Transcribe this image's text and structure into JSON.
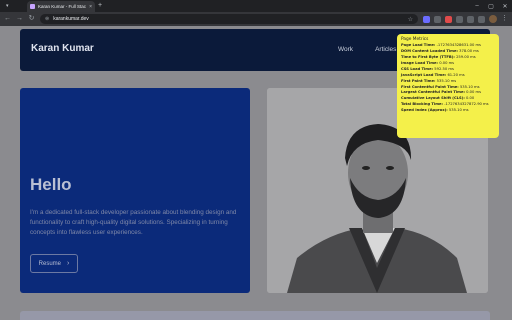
{
  "browser": {
    "tab_title": "Karan Kumar - Full Stack Dev",
    "tab_close": "×",
    "new_tab": "+",
    "url": "karankumar.dev",
    "window_controls": [
      "–",
      "▢",
      "✕"
    ],
    "ext_colors": [
      "#6b6cff",
      "#9aa0a6",
      "#e04b4b",
      "#9aa0a6",
      "#9aa0a6",
      "#9aa0a6"
    ]
  },
  "site": {
    "brand": "Karan Kumar",
    "nav": [
      "Work",
      "Articles"
    ]
  },
  "hero": {
    "title": "Hello",
    "text": "I'm a dedicated full-stack developer passionate about blending design and functionality to craft high-quality digital solutions. Specializing in turning concepts into flawless user experiences.",
    "button_label": "Resume",
    "button_icon": "chevron-right-icon"
  },
  "metrics": {
    "title": "Page Metrics",
    "rows": [
      {
        "label": "Page Load Time:",
        "value": " -1727634328631.00 ms"
      },
      {
        "label": "DOM Content Loaded Time:",
        "value": " 378.00 ms"
      },
      {
        "label": "Time to First Byte (TTFB):",
        "value": " 259.00 ms"
      },
      {
        "label": "Image Load Time:",
        "value": " 0.00 ms"
      },
      {
        "label": "CSS Load Time:",
        "value": " 592.50 ms"
      },
      {
        "label": "JavaScript Load Time:",
        "value": " 61.20 ms"
      },
      {
        "label": "First Paint Time:",
        "value": " 535.10 ms"
      },
      {
        "label": "First Contentful Paint Time:",
        "value": " 535.10 ms"
      },
      {
        "label": "Largest Contentful Paint Time:",
        "value": " 0.00 ms"
      },
      {
        "label": "Cumulative Layout Shift (CLS):",
        "value": " 0.00"
      },
      {
        "label": "Total Blocking Time:",
        "value": " -1727634327872.90 ms"
      },
      {
        "label": "Speed Index (Approx):",
        "value": " 535.10 ms"
      }
    ]
  }
}
